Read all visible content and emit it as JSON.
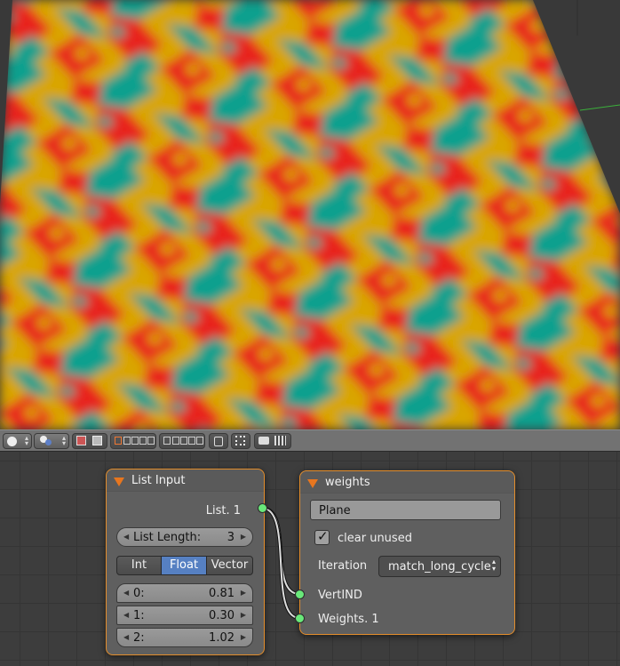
{
  "list_input_node": {
    "title": "List Input",
    "output_socket": "List. 1",
    "list_length_label": "List Length:",
    "list_length_value": "3",
    "types": [
      "Int",
      "Float",
      "Vector"
    ],
    "selected_type": "Float",
    "items": [
      {
        "label": "0:",
        "value": "0.81"
      },
      {
        "label": "1:",
        "value": "0.30"
      },
      {
        "label": "2:",
        "value": "1.02"
      }
    ]
  },
  "weights_node": {
    "title": "weights",
    "object_field": "Plane",
    "clear_unused_label": "clear unused",
    "clear_unused_checked": true,
    "iteration_label": "Iteration",
    "iteration_value": "match_long_cycle",
    "inputs": [
      "VertIND",
      "Weights. 1"
    ]
  },
  "colors": {
    "node_border": "#e38d2b",
    "socket": "#69e87a",
    "selected": "#5680c2",
    "pattern_red": "#e8231b",
    "pattern_teal": "#0fa08e",
    "pattern_yellow": "#d9a500"
  }
}
